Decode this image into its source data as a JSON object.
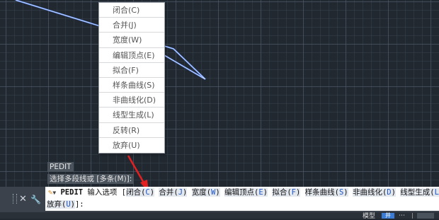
{
  "context_menu": {
    "items": [
      "闭合(C)",
      "合并(J)",
      "宽度(W)",
      "编辑顶点(E)",
      "拟合(F)",
      "样条曲线(S)",
      "非曲线化(D)",
      "线型生成(L)",
      "反转(R)",
      "放弃(U)"
    ]
  },
  "history": {
    "line1": "PEDIT",
    "line2": "选择多段线或 [多条(M)]:"
  },
  "command": {
    "command_name": "PEDIT",
    "prompt": "输入选项",
    "open_bracket": "[",
    "options": [
      {
        "label": "闭合",
        "key": "C"
      },
      {
        "label": "合并",
        "key": "J"
      },
      {
        "label": "宽度",
        "key": "W"
      },
      {
        "label": "编辑顶点",
        "key": "E"
      },
      {
        "label": "拟合",
        "key": "F"
      },
      {
        "label": "样条曲线",
        "key": "S"
      },
      {
        "label": "非曲线化",
        "key": "D"
      },
      {
        "label": "线型生成",
        "key": "L"
      }
    ],
    "line2_label": "放弃",
    "line2_key": "U",
    "line2_suffix": "]:"
  },
  "controls": {
    "close_glyph": "✕",
    "customize_glyph": "🔧"
  },
  "statusbar": {
    "model_tab": "模型",
    "grid_glyph": "井",
    "more_glyph": "⋯"
  },
  "colors": {
    "canvas_bg": "#212830",
    "polyline": "#5b8cff",
    "arrow": "#e41f1f",
    "option_key": "#1c56c4"
  }
}
